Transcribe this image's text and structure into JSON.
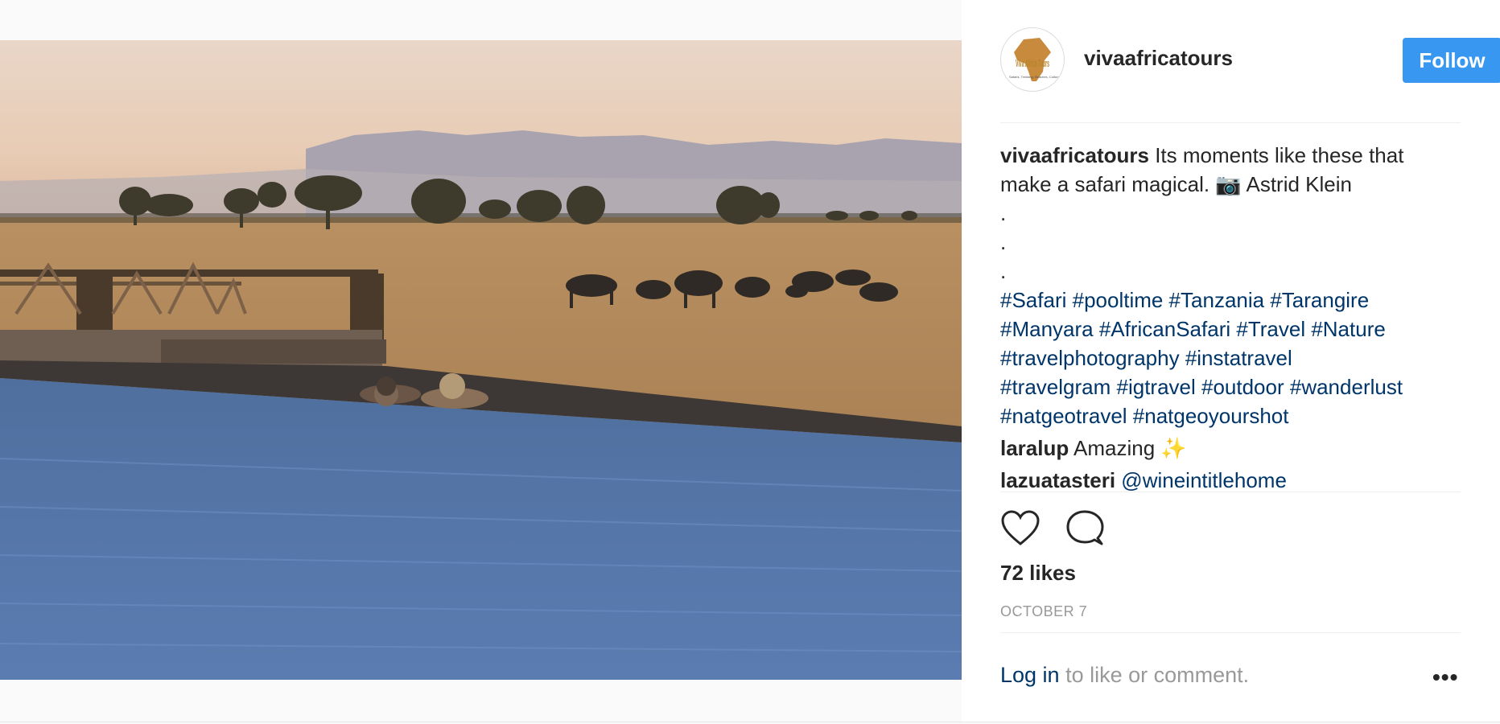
{
  "post": {
    "username": "vivaafricatours",
    "follow_label": "Follow",
    "avatar_logo_text": "Viva Africa Tours",
    "avatar_tagline": "Safaris, Trekking, Beaches, Culture",
    "caption": {
      "text_line1": " Its moments like these that",
      "text_line2": "make a safari magical. 📷  Astrid Klein",
      "dots": [
        ".",
        ".",
        "."
      ],
      "hashtags": [
        "#Safari #pooltime #Tanzania #Tarangire",
        "#Manyara #AfricanSafari #Travel #Nature",
        "#travelphotography #instatravel",
        "#travelgram #igtravel #outdoor #wanderlust",
        "#natgeotravel #natgeoyourshot"
      ]
    },
    "comments": [
      {
        "user": "laralup",
        "text": " Amazing ✨"
      },
      {
        "user": "lazuatasteri",
        "text": " @wineintitlehome"
      }
    ],
    "likes": "72 likes",
    "date": "OCTOBER 7",
    "login_link": "Log in",
    "login_rest": " to like or comment.",
    "more_label": "•••",
    "icons": [
      "heart-icon",
      "comment-icon",
      "more-options-icon"
    ],
    "colors": {
      "follow": "#3897f0",
      "hashtag": "#003569",
      "muted": "#999999"
    }
  }
}
